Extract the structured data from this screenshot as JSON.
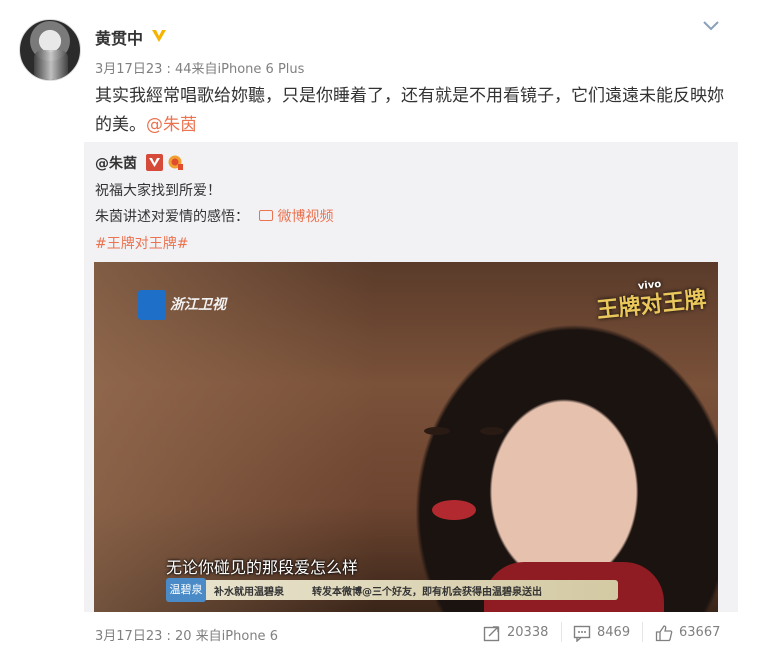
{
  "post": {
    "username": "黄贯中",
    "meta": "3月17日23 : 44来自iPhone 6 Plus",
    "text_main": "其实我經常唱歌给妳聽，只是你睡着了，还有就是不用看镜子，它们遠遠未能反映妳的美。",
    "mention": "@朱茵"
  },
  "repost": {
    "username": "@朱茵",
    "line1": "祝福大家找到所爱！",
    "line2": "朱茵讲述对爱情的感悟：",
    "link_label": "微博视频",
    "hashtag": "#王牌对王牌#",
    "video": {
      "channel": "浙江卫视",
      "show_logo": "王牌对王牌",
      "show_sponsor": "vivo",
      "subtitle": "无论你碰见的那段爱怎么样",
      "ticker_sponsor": "温碧泉",
      "ticker_text1": "补水就用温碧泉",
      "ticker_text2": "转发本微博@三个好友，即有机会获得由温碧泉送出"
    },
    "footer_meta": "3月17日23 : 20 来自iPhone 6",
    "reposts": "20338",
    "comments": "8469",
    "likes": "63667"
  },
  "colors": {
    "accent": "#eb7350",
    "meta": "#808080",
    "repost_bg": "#f2f2f5"
  }
}
